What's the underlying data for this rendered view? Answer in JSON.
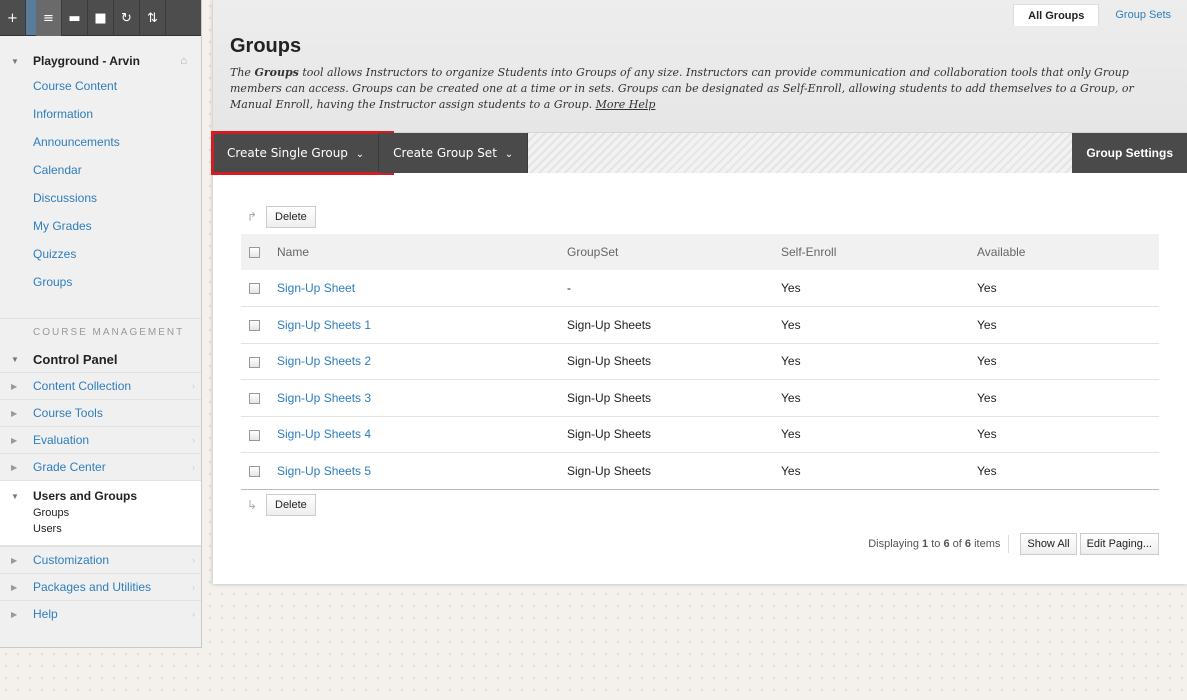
{
  "toolbar": {
    "add_icon": "+",
    "list_icon": "≡",
    "folder_icon": "▬",
    "window_icon": "■",
    "refresh_icon": "↻",
    "sort_icon": "⇅"
  },
  "sidebar": {
    "course_title": "Playground - Arvin",
    "links": [
      "Course Content",
      "Information",
      "Announcements",
      "Calendar",
      "Discussions",
      "My Grades",
      "Quizzes",
      "Groups"
    ],
    "course_management_heading": "COURSE MANAGEMENT",
    "control_panel_title": "Control Panel",
    "cp_items_top": [
      "Content Collection",
      "Course Tools",
      "Evaluation",
      "Grade Center"
    ],
    "users_groups": {
      "title": "Users and Groups",
      "subitems": [
        "Groups",
        "Users"
      ]
    },
    "cp_items_bottom": [
      "Customization",
      "Packages and Utilities",
      "Help"
    ]
  },
  "header": {
    "tabs": [
      {
        "label": "All Groups",
        "active": true
      },
      {
        "label": "Group Sets",
        "active": false
      }
    ],
    "title": "Groups",
    "desc_prefix": "The ",
    "desc_bold": "Groups",
    "desc_body": " tool allows Instructors to organize Students into Groups of any size. Instructors can provide communication and collaboration tools that only Group members can access. Groups can be created one at a time or in sets. Groups can be designated as Self-Enroll, allowing students to add themselves to a Group, or Manual Enroll, having the Instructor assign students to a Group. ",
    "more_help": "More Help"
  },
  "actions": {
    "create_single": "Create Single Group",
    "create_set": "Create Group Set",
    "settings": "Group Settings"
  },
  "table": {
    "delete_label": "Delete",
    "columns": [
      "Name",
      "GroupSet",
      "Self-Enroll",
      "Available"
    ],
    "rows": [
      {
        "name": "Sign-Up Sheet",
        "groupset": "-",
        "self_enroll": "Yes",
        "available": "Yes"
      },
      {
        "name": "Sign-Up Sheets 1",
        "groupset": "Sign-Up Sheets",
        "self_enroll": "Yes",
        "available": "Yes"
      },
      {
        "name": "Sign-Up Sheets 2",
        "groupset": "Sign-Up Sheets",
        "self_enroll": "Yes",
        "available": "Yes"
      },
      {
        "name": "Sign-Up Sheets 3",
        "groupset": "Sign-Up Sheets",
        "self_enroll": "Yes",
        "available": "Yes"
      },
      {
        "name": "Sign-Up Sheets 4",
        "groupset": "Sign-Up Sheets",
        "self_enroll": "Yes",
        "available": "Yes"
      },
      {
        "name": "Sign-Up Sheets 5",
        "groupset": "Sign-Up Sheets",
        "self_enroll": "Yes",
        "available": "Yes"
      }
    ]
  },
  "paging": {
    "prefix": "Displaying ",
    "from": "1",
    "to_word": " to ",
    "to": "6",
    "of_word": " of ",
    "total": "6",
    "suffix": " items",
    "show_all": "Show All",
    "edit_paging": "Edit Paging..."
  },
  "colors": {
    "link": "#2e7dbd",
    "toolbar_bg": "#4d4d4d",
    "action_bg": "#4a4a4a",
    "highlight": "#d51b24"
  }
}
